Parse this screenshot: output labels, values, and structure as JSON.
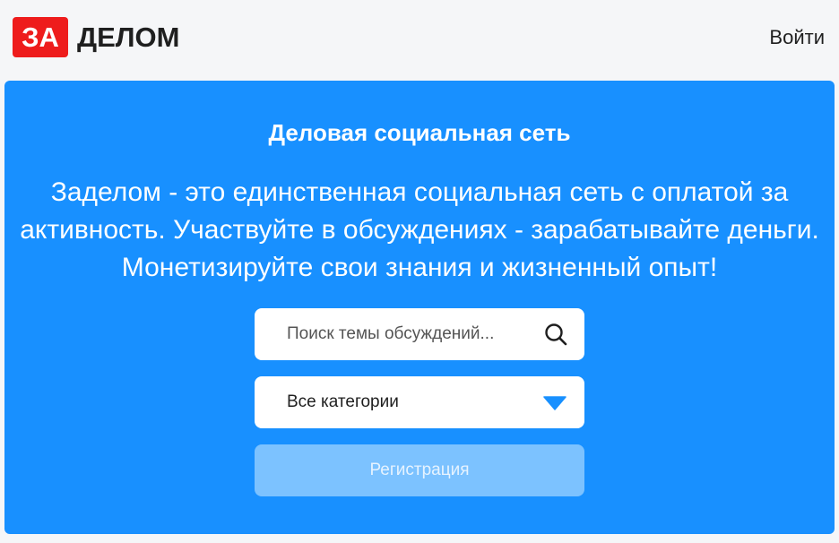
{
  "header": {
    "logo_mark": "ЗА",
    "logo_text": "ДЕЛОМ",
    "login_label": "Войти"
  },
  "hero": {
    "title": "Деловая социальная сеть",
    "description": "Заделом - это единственная социальная сеть с оплатой за активность. Участвуйте в обсуждениях - зарабатывайте деньги. Монетизируйте свои знания и жизненный опыт!"
  },
  "search": {
    "placeholder": "Поиск темы обсуждений...",
    "value": "",
    "icon": "search-icon"
  },
  "category_select": {
    "selected": "Все категории",
    "icon": "caret-down-icon"
  },
  "register": {
    "label": "Регистрация"
  },
  "colors": {
    "brand_red": "#ee1c1c",
    "hero_blue": "#1890ff",
    "register_disabled": "#7cc2ff",
    "page_bg": "#f5f6f8"
  }
}
